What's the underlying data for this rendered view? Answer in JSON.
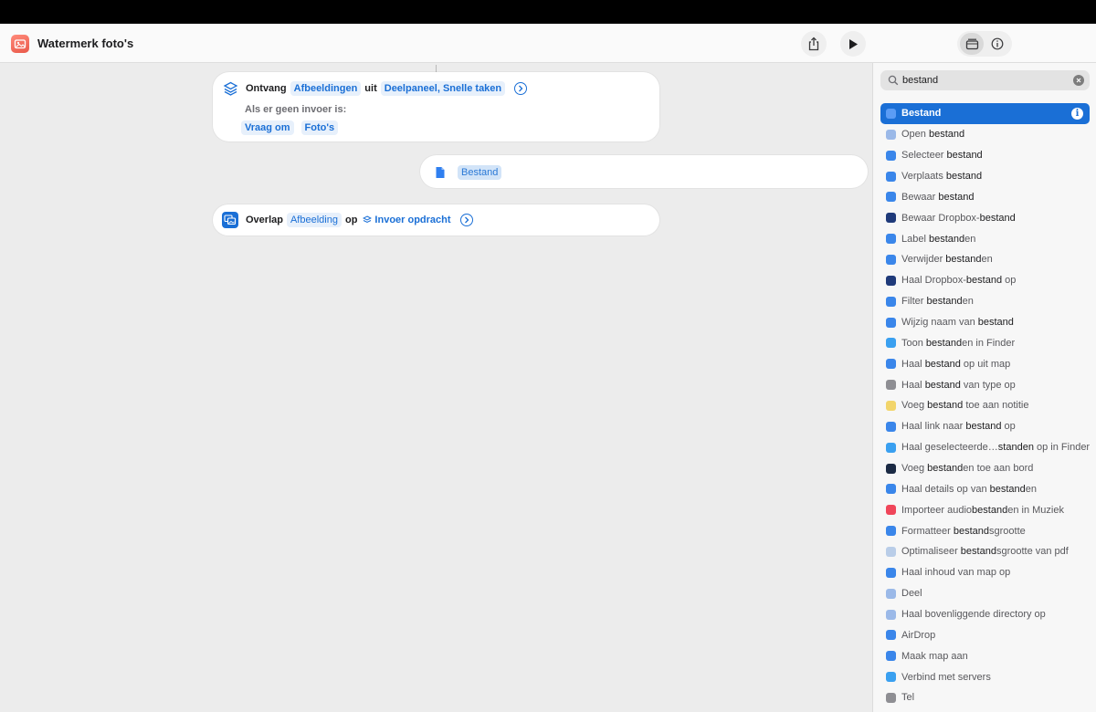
{
  "window": {
    "title": "Watermerk foto's"
  },
  "toolbar": {
    "share_icon": "share-icon",
    "run_icon": "play-icon",
    "library_icon": "library-icon",
    "info_icon": "info-icon"
  },
  "actions": {
    "receive": {
      "verb": "Ontvang",
      "type_token": "Afbeeldingen",
      "from_label": "uit",
      "sources_token": "Deelpaneel, Snelle taken",
      "no_input_label": "Als er geen invoer is:",
      "ask_token": "Vraag om",
      "photos_token": "Foto's"
    },
    "file": {
      "token": "Bestand"
    },
    "overlay": {
      "verb": "Overlap",
      "image_token": "Afbeelding",
      "on_label": "op",
      "input_token": "Invoer opdracht"
    }
  },
  "sidebar": {
    "search": {
      "value": "bestand"
    },
    "results": [
      {
        "pre": "",
        "em": "Bestand",
        "post": "",
        "icon_color": "#2f7ff0"
      },
      {
        "pre": "Open ",
        "em": "bestand",
        "post": "",
        "icon_color": "#9bb9e8"
      },
      {
        "pre": "Selecteer ",
        "em": "bestand",
        "post": "",
        "icon_color": "#3a86ea"
      },
      {
        "pre": "Verplaats ",
        "em": "bestand",
        "post": "",
        "icon_color": "#3a86ea"
      },
      {
        "pre": "Bewaar ",
        "em": "bestand",
        "post": "",
        "icon_color": "#3a86ea"
      },
      {
        "pre": "Bewaar Dropbox-",
        "em": "bestand",
        "post": "",
        "icon_color": "#1f3a7a"
      },
      {
        "pre": "Label ",
        "em": "bestand",
        "post": "en",
        "icon_color": "#3a86ea"
      },
      {
        "pre": "Verwijder ",
        "em": "bestand",
        "post": "en",
        "icon_color": "#3a86ea"
      },
      {
        "pre": "Haal Dropbox-",
        "em": "bestand",
        "post": " op",
        "icon_color": "#1f3a7a"
      },
      {
        "pre": "Filter ",
        "em": "bestand",
        "post": "en",
        "icon_color": "#3a86ea"
      },
      {
        "pre": "Wijzig naam van ",
        "em": "bestand",
        "post": "",
        "icon_color": "#3a86ea"
      },
      {
        "pre": "Toon ",
        "em": "bestand",
        "post": "en in Finder",
        "icon_color": "#3aa0f0"
      },
      {
        "pre": "Haal ",
        "em": "bestand",
        "post": " op uit map",
        "icon_color": "#3a86ea"
      },
      {
        "pre": "Haal ",
        "em": "bestand",
        "post": " van type op",
        "icon_color": "#8e8e93"
      },
      {
        "pre": "Voeg ",
        "em": "bestand",
        "post": " toe aan notitie",
        "icon_color": "#f2d56b"
      },
      {
        "pre": "Haal link naar ",
        "em": "bestand",
        "post": " op",
        "icon_color": "#3a86ea"
      },
      {
        "pre": "Haal geselecteerde…",
        "em": "standen",
        "post": " op in Finder",
        "icon_color": "#3aa0f0"
      },
      {
        "pre": "Voeg ",
        "em": "bestand",
        "post": "en toe aan bord",
        "icon_color": "#1b2a44"
      },
      {
        "pre": "Haal details op van ",
        "em": "bestand",
        "post": "en",
        "icon_color": "#3a86ea"
      },
      {
        "pre": "Importeer audio",
        "em": "bestand",
        "post": "en in Muziek",
        "icon_color": "#f0465a"
      },
      {
        "pre": "Formatteer ",
        "em": "bestand",
        "post": "sgrootte",
        "icon_color": "#3a86ea"
      },
      {
        "pre": "Optimaliseer ",
        "em": "bestand",
        "post": "sgrootte van pdf",
        "icon_color": "#b9cde8"
      },
      {
        "pre": "Haal inhoud van map op",
        "em": "",
        "post": "",
        "icon_color": "#3a86ea"
      },
      {
        "pre": "Deel",
        "em": "",
        "post": "",
        "icon_color": "#9bb9e8"
      },
      {
        "pre": "Haal bovenliggende directory op",
        "em": "",
        "post": "",
        "icon_color": "#9bb9e8"
      },
      {
        "pre": "AirDrop",
        "em": "",
        "post": "",
        "icon_color": "#3a86ea"
      },
      {
        "pre": "Maak map aan",
        "em": "",
        "post": "",
        "icon_color": "#3a86ea"
      },
      {
        "pre": "Verbind met servers",
        "em": "",
        "post": "",
        "icon_color": "#3aa0f0"
      },
      {
        "pre": "Tel",
        "em": "",
        "post": "",
        "icon_color": "#8e8e93"
      }
    ]
  }
}
